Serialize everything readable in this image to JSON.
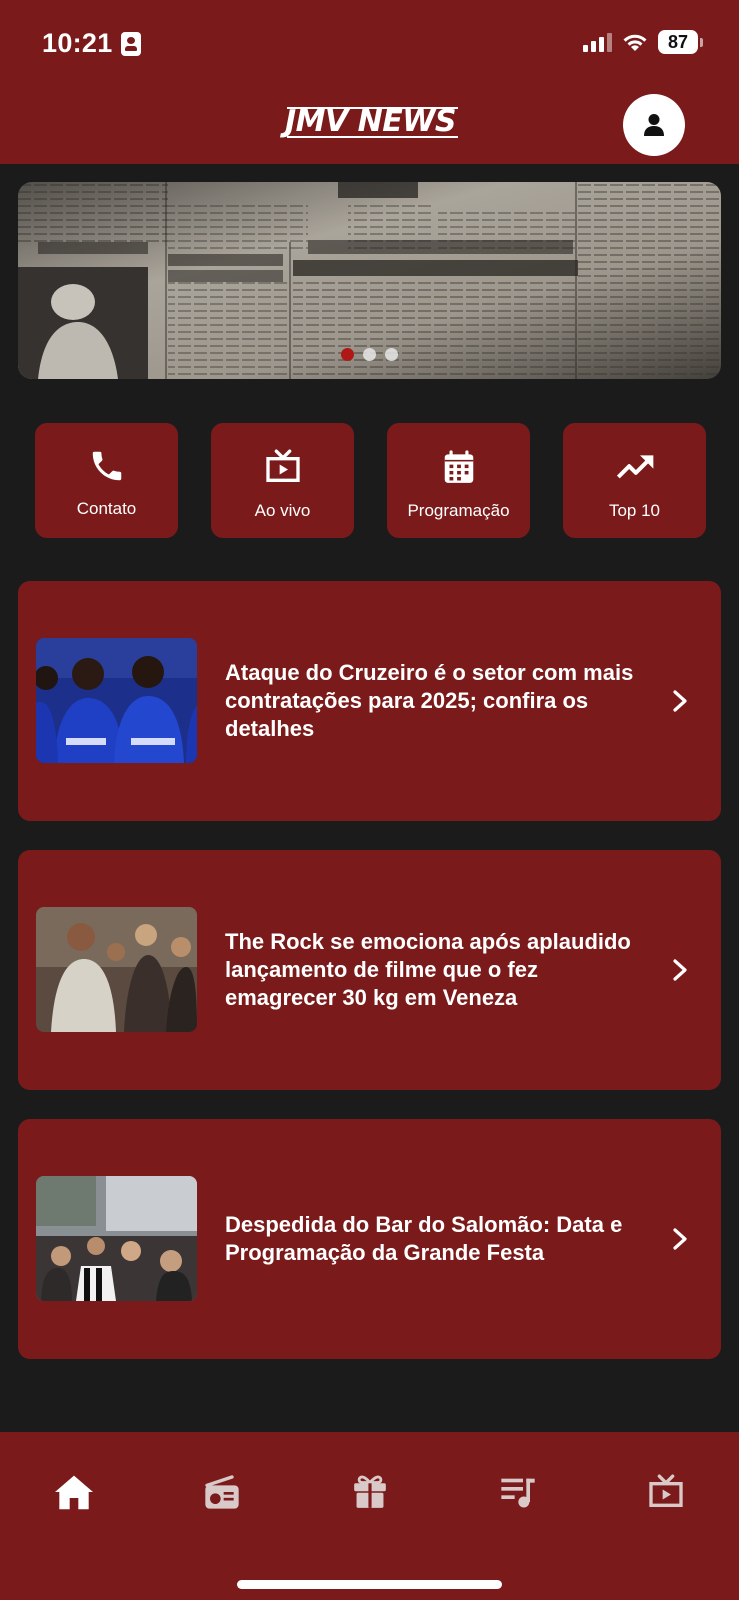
{
  "status_bar": {
    "time": "10:21",
    "battery": "87"
  },
  "header": {
    "logo_text": "JMV NEWS"
  },
  "banner": {
    "slide_count": 3,
    "active_slide": 1
  },
  "quick_actions": [
    {
      "label": "Contato",
      "icon": "phone-icon"
    },
    {
      "label": "Ao vivo",
      "icon": "tv-play-icon"
    },
    {
      "label": "Programação",
      "icon": "calendar-icon"
    },
    {
      "label": "Top 10",
      "icon": "trending-up-icon"
    }
  ],
  "news": [
    {
      "title": "Ataque do Cruzeiro é o setor com mais contratações para 2025; confira os detalhes"
    },
    {
      "title": "The Rock se emociona após aplaudido lançamento de filme que o fez emagrecer 30 kg em Veneza"
    },
    {
      "title": "Despedida do Bar do Salomão: Data e Programação da Grande Festa"
    }
  ],
  "bottom_nav": {
    "items": [
      "home-icon",
      "radio-icon",
      "gift-icon",
      "playlist-icon",
      "tv-play-icon"
    ],
    "active": "home-icon"
  },
  "colors": {
    "primary": "#7b1a1a",
    "background": "#1b1b1b",
    "accent_dot": "#b01818"
  }
}
